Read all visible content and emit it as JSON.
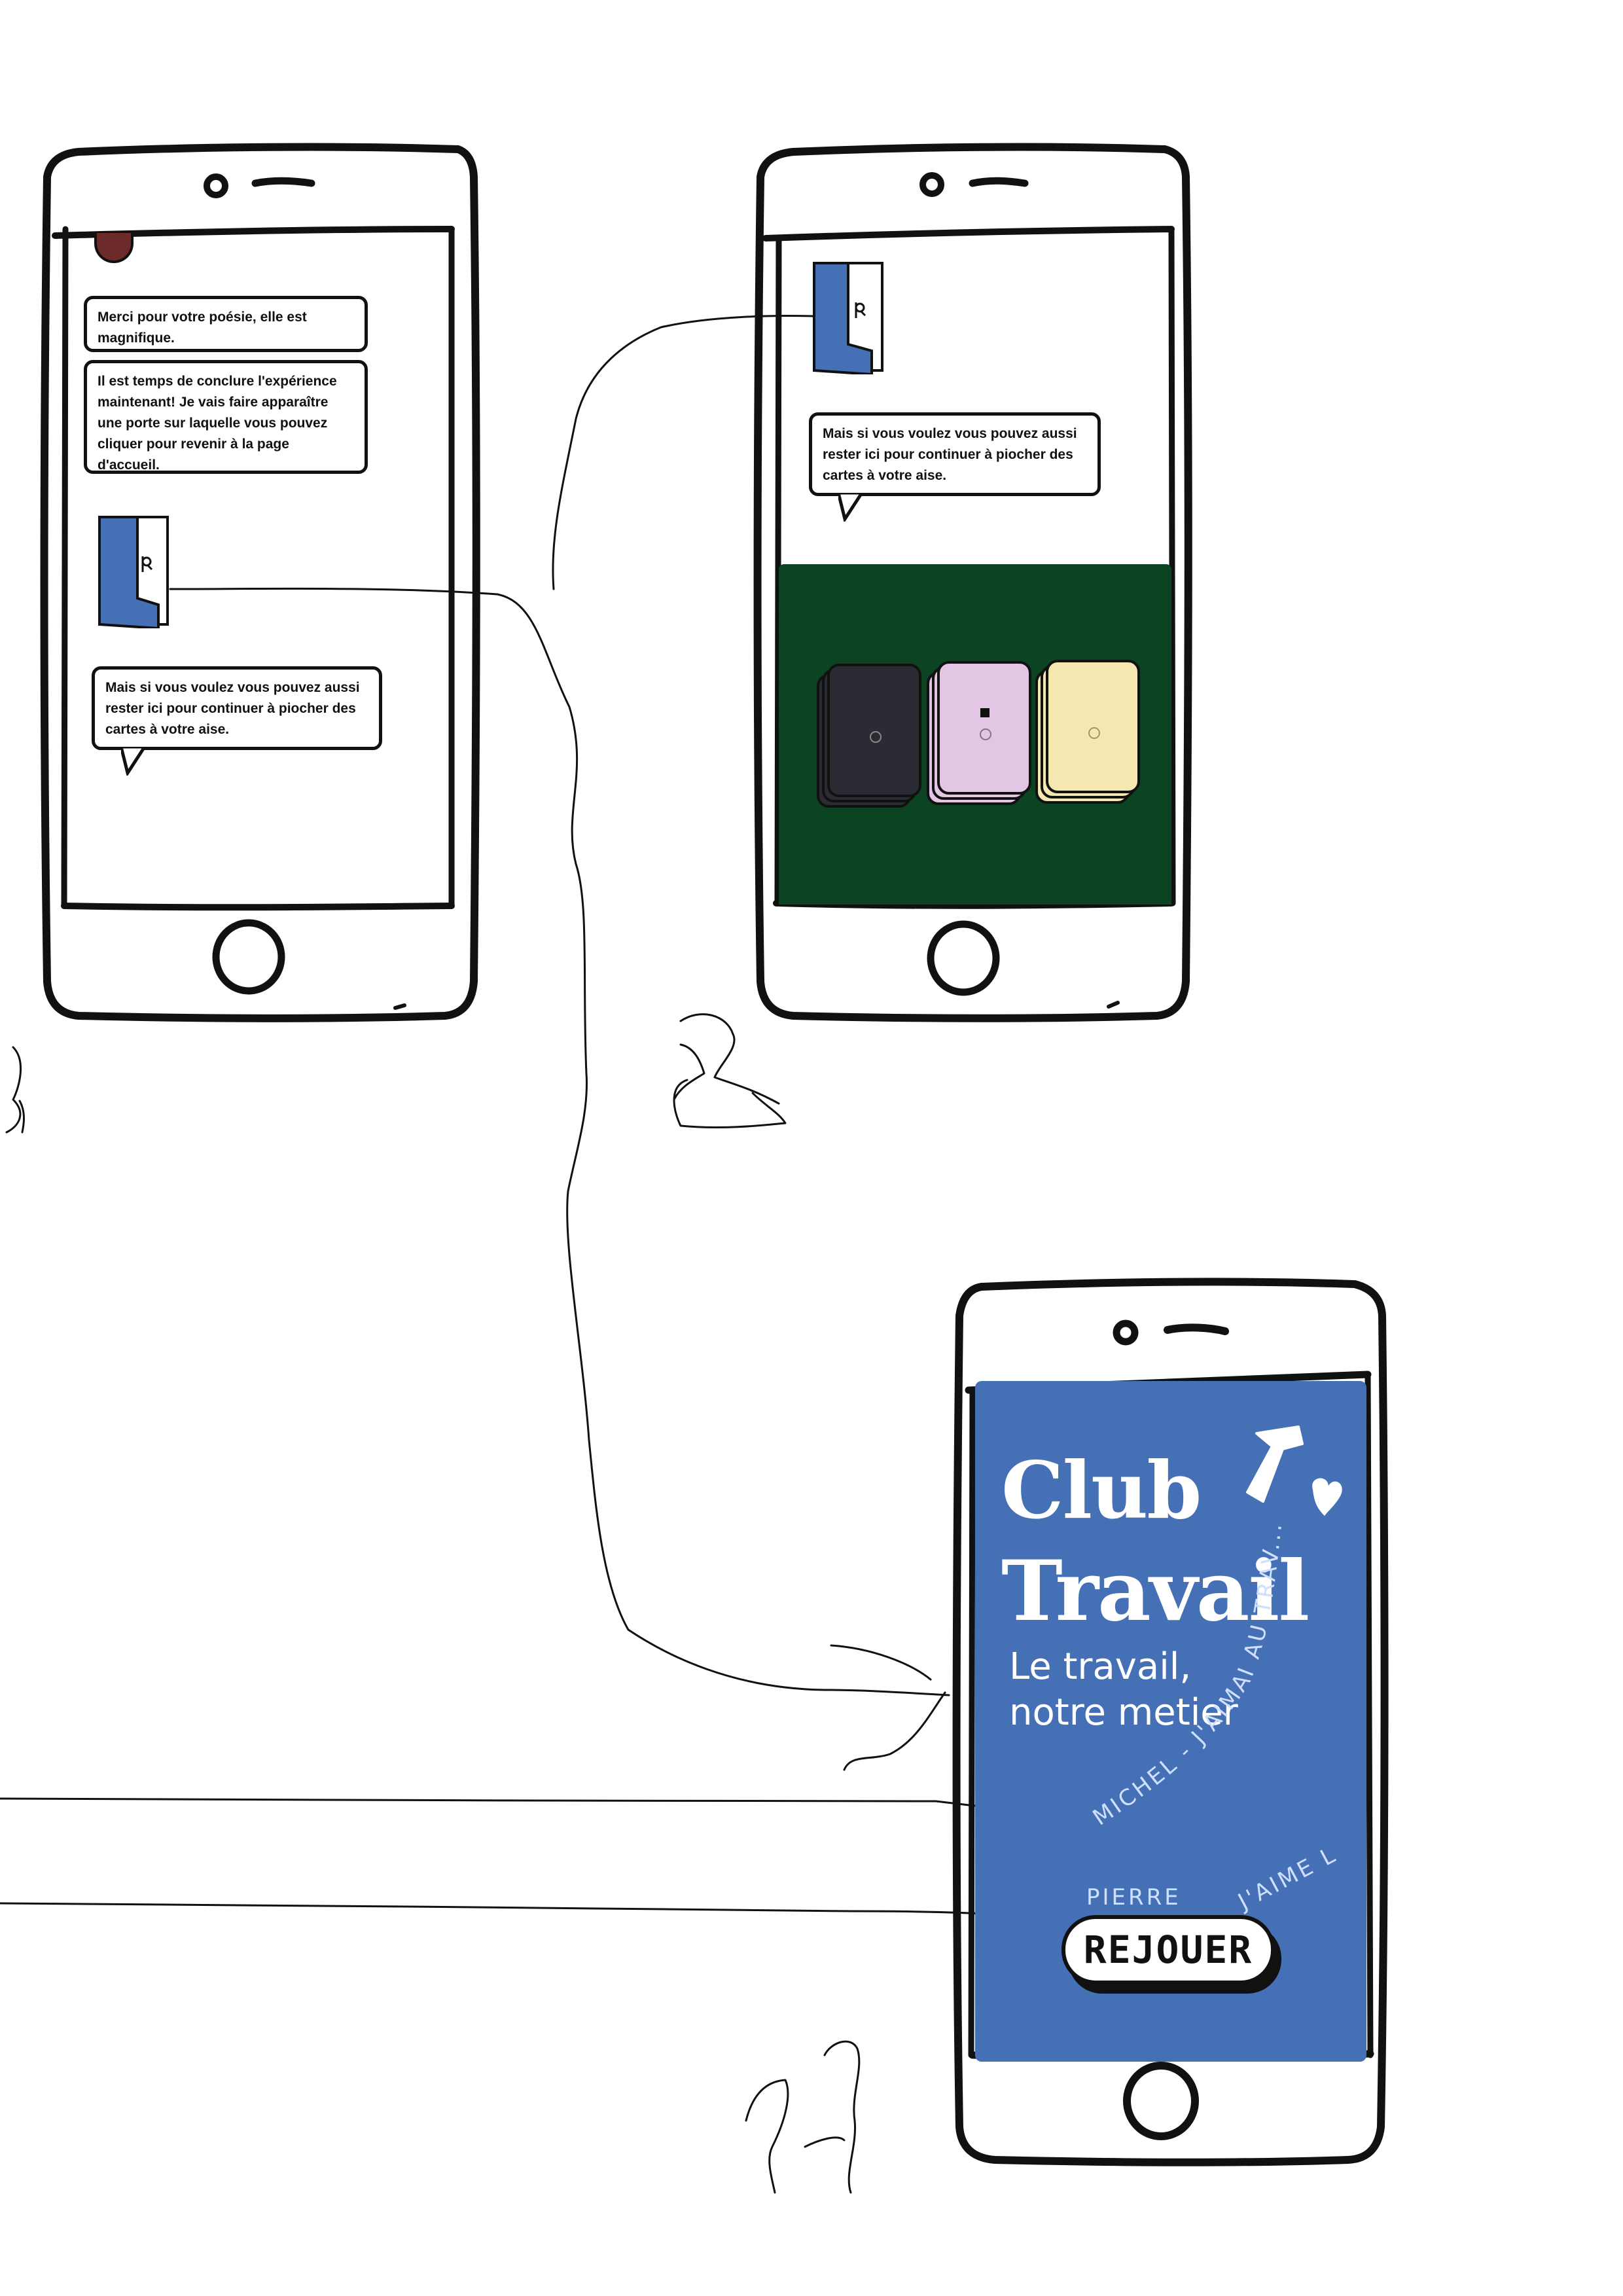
{
  "phone_left": {
    "bubbles": [
      "Merci pour votre poésie, elle est magnifique.",
      "Il est temps de conclure l'expérience maintenant! Je vais faire apparaître une porte sur laquelle vous pouvez cliquer pour revenir à la page d'accueil.",
      "Mais si vous voulez vous pouvez aussi rester ici pour continuer à piocher des cartes à votre aise."
    ]
  },
  "phone_middle": {
    "bubbles": [
      "Mais si vous voulez vous pouvez aussi rester ici pour continuer à piocher des cartes à votre aise."
    ],
    "decks": [
      {
        "color": "#2b2b33",
        "name": "deck-dark"
      },
      {
        "color": "#e2c6e3",
        "name": "deck-pink"
      },
      {
        "color": "#f4e7b0",
        "name": "deck-yellow"
      }
    ],
    "table_color": "#0c4322"
  },
  "phone_right": {
    "title_line1": "Club",
    "title_line2": "Travail",
    "subtitle_line1": "Le travail,",
    "subtitle_line2": "notre metier",
    "handwritten_1": "MICHEL - J'AIMAI AU TRAV...",
    "handwritten_2": "PIERRE",
    "handwritten_3": "J'AIME L",
    "replay_label": "REJOUER",
    "background_color": "#4570b6"
  },
  "colors": {
    "ink": "#111111",
    "door_blue": "#4570b6"
  }
}
